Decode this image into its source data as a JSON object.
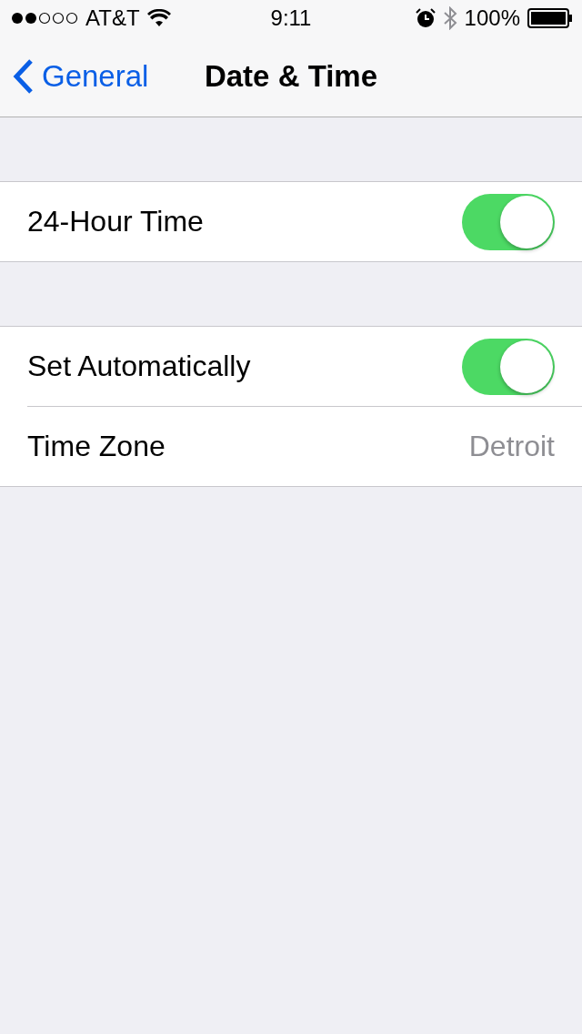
{
  "status_bar": {
    "carrier": "AT&T",
    "time": "9:11",
    "battery": "100%"
  },
  "nav_bar": {
    "back": "General",
    "title": "Date & Time"
  },
  "sections": [
    {
      "rows": [
        {
          "kind": "toggle",
          "label": "24-Hour Time",
          "on": true
        }
      ]
    },
    {
      "rows": [
        {
          "kind": "toggle",
          "label": "Set Automatically",
          "on": true
        },
        {
          "kind": "value",
          "label": "Time Zone",
          "value": "Detroit"
        }
      ]
    }
  ]
}
